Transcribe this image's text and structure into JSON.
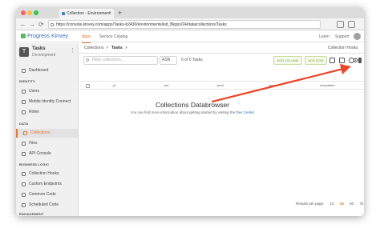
{
  "browser": {
    "tab_title": "Collection - Environment",
    "new_tab": "+",
    "tab_close": "×",
    "url": "https://console.kinvey.com/apps/Tasks-b2430/environments/kid_Bkgsv/24/data/collections/Tasks",
    "nav_back": "←",
    "nav_forward": "→",
    "nav_reload": "⟳"
  },
  "header": {
    "logo": "Progress Kinvey",
    "tabs": [
      "Apps",
      "Service Catalog"
    ],
    "active_tab": "Apps",
    "links": [
      "Learn",
      "Support"
    ]
  },
  "sidebar": {
    "app_initial": "T",
    "app_name": "Tasks",
    "env_name": "Development",
    "more": "⋮",
    "items": [
      {
        "label": "Dashboard"
      },
      {
        "label": "IDENTITY",
        "section": true
      },
      {
        "label": "Users"
      },
      {
        "label": "Mobile Identity Connect"
      },
      {
        "label": "Roles"
      },
      {
        "label": "DATA",
        "section": true
      },
      {
        "label": "Collections",
        "active": true
      },
      {
        "label": "Files"
      },
      {
        "label": "API Console"
      },
      {
        "label": "BUSINESS LOGIC",
        "section": true
      },
      {
        "label": "Collection Hooks"
      },
      {
        "label": "Custom Endpoints"
      },
      {
        "label": "Common Code"
      },
      {
        "label": "Scheduled Code"
      },
      {
        "label": "ENGAGEMENT",
        "section": true
      }
    ]
  },
  "main": {
    "breadcrumb": [
      "Collections",
      "Tasks"
    ],
    "breadcrumb_sep": ">",
    "collection_hooks": "Collection Hooks",
    "filter_placeholder": "Filter collections...",
    "sel_value": "ASN",
    "count_text": "0 of 0 Tasks",
    "add_column": "ADD COLUMN",
    "add_row": "ADD ROW",
    "gear": "⚙",
    "columns": [
      "_id",
      "_acl",
      "_kmd",
      "name",
      "completed"
    ],
    "empty_title": "Collections Databrowser",
    "empty_sub_prefix": "You can find more information about getting started by visiting the ",
    "empty_sub_link": "Dev Center",
    "pager_label": "Results per page:",
    "pager_options": [
      "10",
      "25",
      "50",
      "75"
    ],
    "pager_active": "25"
  },
  "colors": {
    "accent": "#e8762c",
    "arrow": "#e8472c",
    "green": "#7aa83a"
  }
}
